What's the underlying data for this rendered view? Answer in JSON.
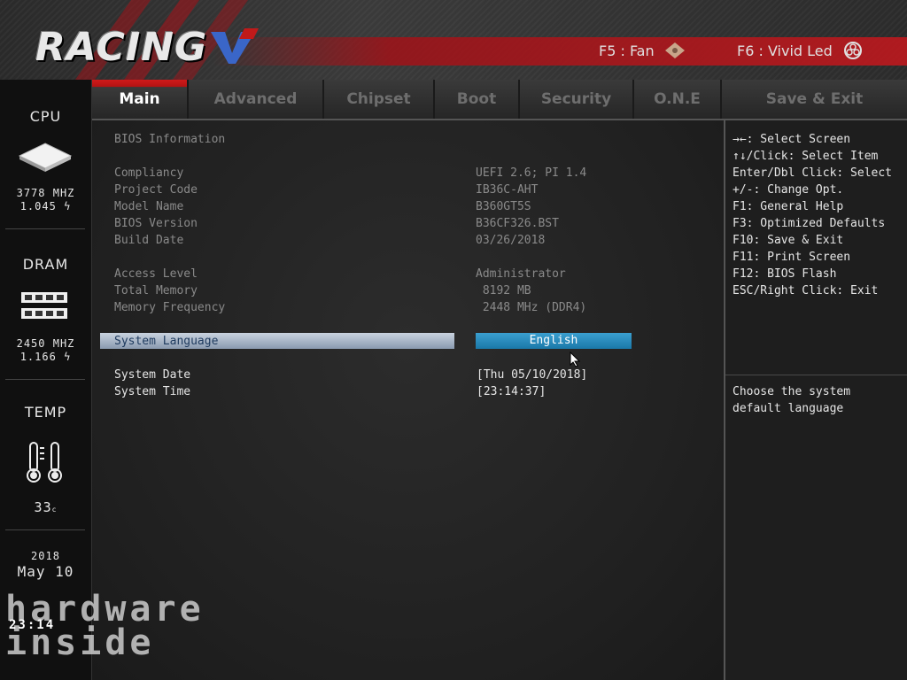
{
  "header": {
    "logo_text": "RACING",
    "hotkeys": [
      {
        "label": "F5 : Fan",
        "icon": "fan-icon"
      },
      {
        "label": "F6 : Vivid Led",
        "icon": "led-icon"
      }
    ]
  },
  "sidebar": {
    "cpu": {
      "label": "CPU",
      "icon": "cpu-chip-icon",
      "freq": "3778 MHZ",
      "volt": "1.045"
    },
    "dram": {
      "label": "DRAM",
      "icon": "memory-module-icon",
      "freq": "2450 MHZ",
      "volt": "1.166"
    },
    "temp": {
      "label": "TEMP",
      "icon": "thermometer-icon",
      "value": "33",
      "unit": "c"
    },
    "date": {
      "year": "2018",
      "month_day": "May 10"
    }
  },
  "tabs": [
    {
      "label": "Main",
      "active": true
    },
    {
      "label": "Advanced",
      "active": false
    },
    {
      "label": "Chipset",
      "active": false
    },
    {
      "label": "Boot",
      "active": false
    },
    {
      "label": "Security",
      "active": false
    },
    {
      "label": "O.N.E",
      "active": false
    },
    {
      "label": "Save & Exit",
      "active": false
    }
  ],
  "main": {
    "section_title": "BIOS Information",
    "bios_info": [
      {
        "label": "Compliancy",
        "value": "UEFI 2.6; PI 1.4"
      },
      {
        "label": "Project Code",
        "value": "IB36C-AHT"
      },
      {
        "label": "Model Name",
        "value": "B360GT5S"
      },
      {
        "label": "BIOS Version",
        "value": "B36CF326.BST"
      },
      {
        "label": "Build Date",
        "value": "03/26/2018"
      }
    ],
    "system_info": [
      {
        "label": "Access Level",
        "value": "Administrator"
      },
      {
        "label": "Total Memory",
        "value": " 8192 MB"
      },
      {
        "label": "Memory Frequency",
        "value": " 2448 MHz (DDR4)"
      }
    ],
    "language": {
      "label": "System Language",
      "value": "English"
    },
    "date": {
      "label": "System Date",
      "value": "[Thu 05/10/2018]"
    },
    "time": {
      "label": "System Time",
      "value": "[23:14:37]"
    }
  },
  "help": {
    "keys": [
      "→←: Select Screen",
      "↑↓/Click: Select Item",
      "Enter/Dbl Click: Select",
      "+/-: Change Opt.",
      "F1: General Help",
      "F3: Optimized Defaults",
      "F10: Save & Exit",
      "F11: Print Screen",
      "F12: BIOS Flash",
      "ESC/Right Click: Exit"
    ],
    "description": [
      "Choose the system",
      "default language"
    ]
  },
  "watermark": {
    "line1": "hardware",
    "line2": "inside",
    "clock": "23:14"
  }
}
